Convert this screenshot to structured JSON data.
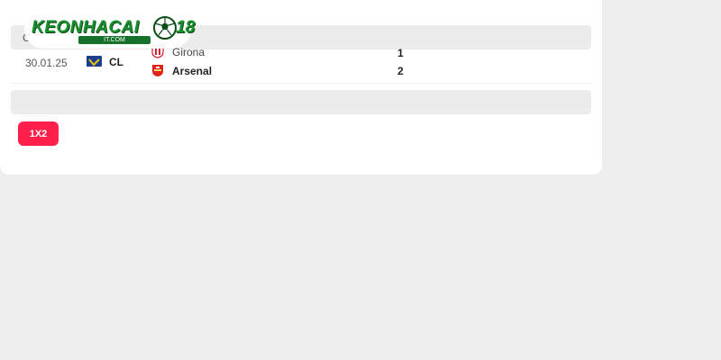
{
  "header": {
    "letter": "C"
  },
  "match": {
    "date": "30.01.25",
    "league": "CL",
    "home_team": "Girona",
    "away_team": "Arsenal",
    "home_score": "1",
    "away_score": "2"
  },
  "tabs": {
    "active_label": "1X2"
  },
  "logo": {
    "brand": "KEONHACAI 18",
    "sub": "IT.COM"
  },
  "colors": {
    "accent": "#ff1f4b",
    "brand_green": "#1a8f2e"
  }
}
